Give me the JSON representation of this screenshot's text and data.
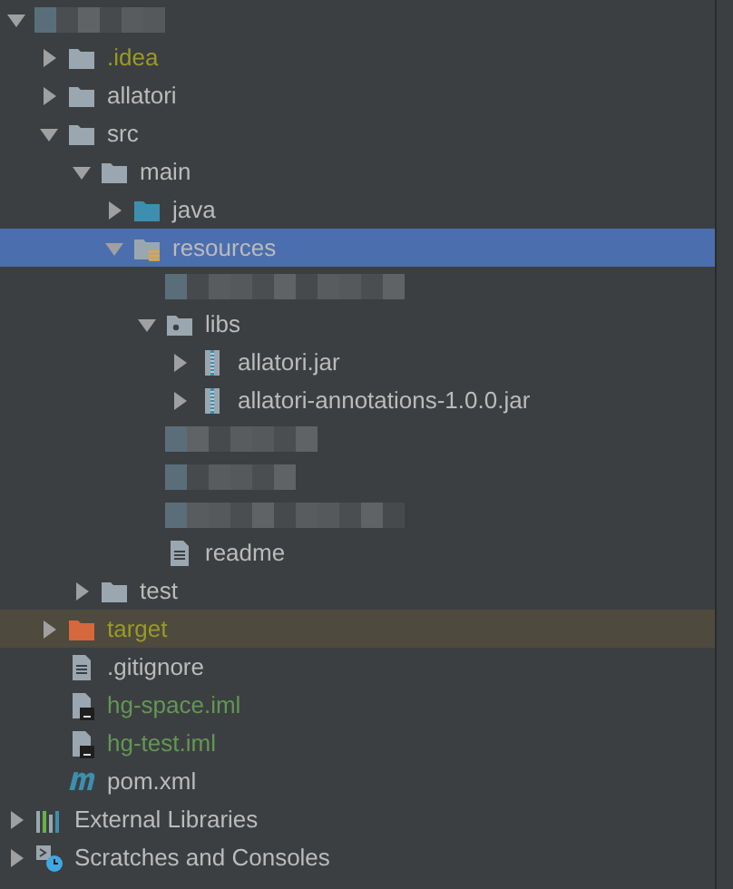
{
  "tree": [
    {
      "kind": "blurred",
      "expanded": true,
      "selected": false,
      "children": [
        {
          "kind": "folder",
          "label": ".idea",
          "color": "#9a9a28",
          "expanded": false,
          "selected": false
        },
        {
          "kind": "folder",
          "label": "allatori",
          "color": "#bbbbbb",
          "expanded": false,
          "selected": false
        },
        {
          "kind": "folder",
          "label": "src",
          "color": "#bbbbbb",
          "expanded": true,
          "selected": false,
          "children": [
            {
              "kind": "folder",
              "label": "main",
              "color": "#bbbbbb",
              "expanded": true,
              "selected": false,
              "children": [
                {
                  "kind": "source-folder",
                  "label": "java",
                  "color": "#bbbbbb",
                  "expanded": false,
                  "selected": false
                },
                {
                  "kind": "resources-folder",
                  "label": "resources",
                  "color": "#bbbbbb",
                  "expanded": true,
                  "selected": true,
                  "children": [
                    {
                      "kind": "blurred",
                      "selected": false
                    },
                    {
                      "kind": "package",
                      "label": "libs",
                      "color": "#bbbbbb",
                      "expanded": true,
                      "selected": false,
                      "children": [
                        {
                          "kind": "jar",
                          "label": "allatori.jar",
                          "color": "#bbbbbb",
                          "expanded": false,
                          "selected": false
                        },
                        {
                          "kind": "jar",
                          "label": "allatori-annotations-1.0.0.jar",
                          "color": "#bbbbbb",
                          "expanded": false,
                          "selected": false
                        }
                      ]
                    },
                    {
                      "kind": "blurred",
                      "selected": false
                    },
                    {
                      "kind": "blurred",
                      "selected": false
                    },
                    {
                      "kind": "blurred",
                      "selected": false
                    },
                    {
                      "kind": "text-file",
                      "label": "readme",
                      "color": "#bbbbbb",
                      "selected": false
                    }
                  ]
                }
              ]
            },
            {
              "kind": "folder",
              "label": "test",
              "color": "#bbbbbb",
              "expanded": false,
              "selected": false
            }
          ]
        },
        {
          "kind": "excluded-folder",
          "label": "target",
          "color": "#9a9a28",
          "expanded": false,
          "selected": false
        },
        {
          "kind": "text-file",
          "label": ".gitignore",
          "color": "#bbbbbb",
          "selected": false
        },
        {
          "kind": "module-file",
          "label": "hg-space.iml",
          "color": "#629755",
          "selected": false
        },
        {
          "kind": "module-file",
          "label": "hg-test.iml",
          "color": "#629755",
          "selected": false
        },
        {
          "kind": "maven-file",
          "label": "pom.xml",
          "color": "#bbbbbb",
          "selected": false
        }
      ]
    },
    {
      "kind": "libraries",
      "label": "External Libraries",
      "color": "#bbbbbb",
      "expanded": false,
      "selected": false
    },
    {
      "kind": "scratches",
      "label": "Scratches and Consoles",
      "color": "#bbbbbb",
      "expanded": false,
      "selected": false
    }
  ]
}
